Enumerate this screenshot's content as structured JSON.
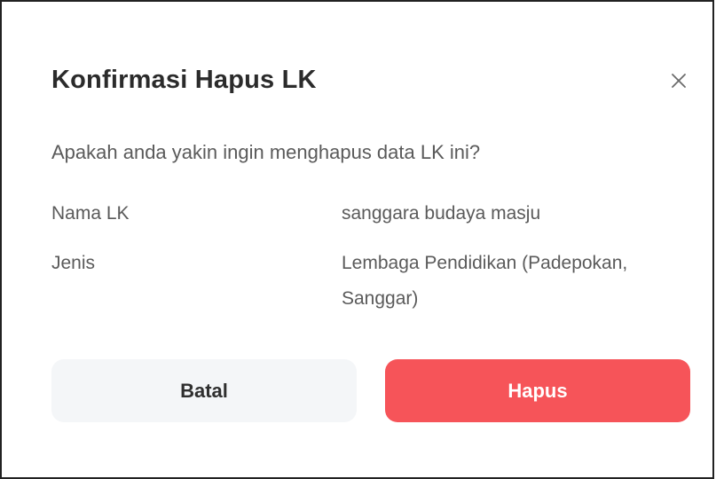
{
  "dialog": {
    "title": "Konfirmasi Hapus LK",
    "message": "Apakah anda yakin ingin menghapus data LK ini?",
    "close_icon": "close-icon",
    "fields": [
      {
        "label": "Nama LK",
        "value": "sanggara budaya masju"
      },
      {
        "label": "Jenis",
        "value": "Lembaga Pendidikan (Padepokan, Sanggar)"
      }
    ],
    "cancel_label": "Batal",
    "delete_label": "Hapus"
  },
  "colors": {
    "delete_button_bg": "#f65459",
    "cancel_button_bg": "#f4f6f8",
    "title_text": "#2b2b2b",
    "body_text": "#5a5a5a"
  }
}
